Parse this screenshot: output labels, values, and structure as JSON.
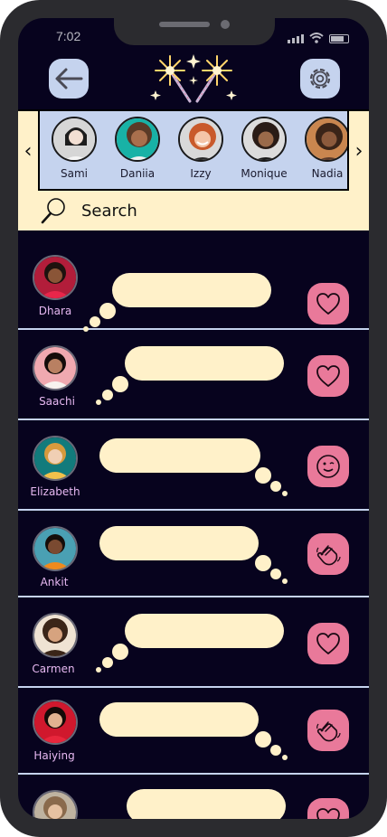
{
  "status_bar": {
    "time": "7:02"
  },
  "header": {
    "back_icon": "arrow-left-icon",
    "logo": "sparklers-logo",
    "settings_icon": "gear-icon"
  },
  "stories": {
    "prev_arrow": "‹",
    "next_arrow": "›",
    "items": [
      {
        "name": "Sami",
        "color": "#d6d6d6"
      },
      {
        "name": "Daniia",
        "color": "#18b2a6"
      },
      {
        "name": "Izzy",
        "color": "#e99b82"
      },
      {
        "name": "Monique",
        "color": "#dcdcdc"
      },
      {
        "name": "Nadia",
        "color": "#c9864f"
      }
    ]
  },
  "search": {
    "label": "Search",
    "icon": "search-icon"
  },
  "feed": [
    {
      "name": "Dhara",
      "reaction": "heart-icon",
      "avatar_color": "#b21d3a"
    },
    {
      "name": "Saachi",
      "reaction": "heart-icon",
      "avatar_color": "#f0a9b0"
    },
    {
      "name": "Elizabeth",
      "reaction": "wink-icon",
      "avatar_color": "#127b7c"
    },
    {
      "name": "Ankit",
      "reaction": "wave-icon",
      "avatar_color": "#4aa0b3"
    },
    {
      "name": "Carmen",
      "reaction": "heart-icon",
      "avatar_color": "#efe3d3"
    },
    {
      "name": "Haiying",
      "reaction": "wave-icon",
      "avatar_color": "#d0182d"
    },
    {
      "name": "",
      "reaction": "heart-icon",
      "avatar_color": "#bfb3a0"
    }
  ],
  "colors": {
    "background": "#07031e",
    "accent_blue": "#c5d3ee",
    "cream": "#fff1c9",
    "pink": "#e9799a",
    "name_lilac": "#e7b9f2"
  }
}
